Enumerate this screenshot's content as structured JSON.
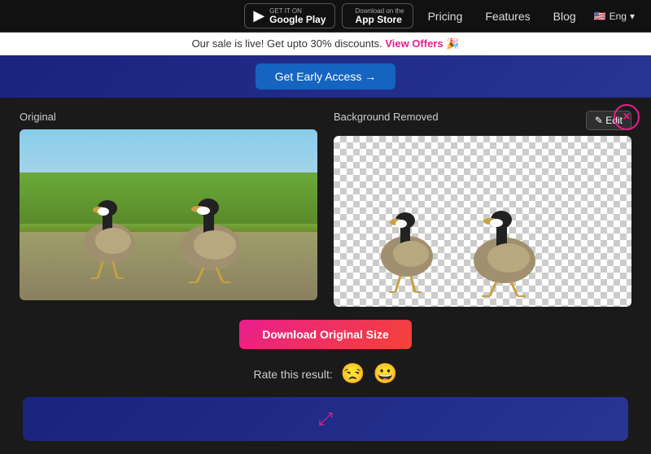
{
  "header": {
    "google_play_sub": "GET IT ON",
    "google_play_name": "Google Play",
    "app_store_sub": "Download on the",
    "app_store_name": "App Store",
    "nav": {
      "pricing": "Pricing",
      "features": "Features",
      "blog": "Blog",
      "lang": "Eng"
    }
  },
  "sale_banner": {
    "text": "Our sale is live! Get upto 30% discounts.",
    "link_text": "View Offers",
    "emoji": "🎉"
  },
  "early_access": {
    "button_label": "Get Early Access →"
  },
  "comparison": {
    "original_label": "Original",
    "removed_label": "Background Removed",
    "edit_label": "✎ Edit",
    "close_label": "×"
  },
  "download": {
    "button_label": "Download Original Size"
  },
  "rating": {
    "label": "Rate this result:",
    "sad_emoji": "😒",
    "happy_emoji": "😀"
  },
  "bottom_bar": {
    "expand_icon": "⤢"
  }
}
